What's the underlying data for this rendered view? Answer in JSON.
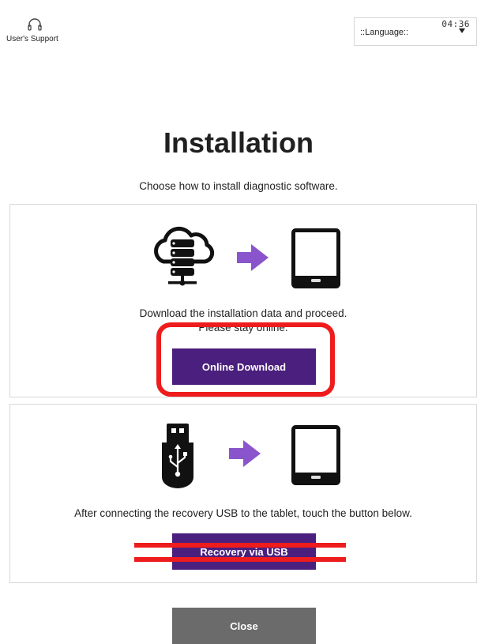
{
  "header": {
    "support_label": "User's Support",
    "language_label": "::Language::",
    "time": "04:36"
  },
  "page": {
    "title": "Installation",
    "subtitle": "Choose how to install diagnostic software."
  },
  "online": {
    "description_line1": "Download the installation data and proceed.",
    "description_line2": "Please stay online.",
    "button_label": "Online Download",
    "icons": [
      "cloud-server-icon",
      "arrow-right-icon",
      "tablet-icon"
    ]
  },
  "usb": {
    "description": "After connecting the recovery USB to the tablet, touch the button below.",
    "button_label": "Recovery via USB",
    "icons": [
      "usb-drive-icon",
      "arrow-right-icon",
      "tablet-icon"
    ]
  },
  "footer": {
    "close_label": "Close"
  },
  "colors": {
    "primary_button": "#4b1f7d",
    "close_button": "#6b6b6b",
    "arrow": "#8a55cc",
    "annotation": "#ee1c1c"
  }
}
